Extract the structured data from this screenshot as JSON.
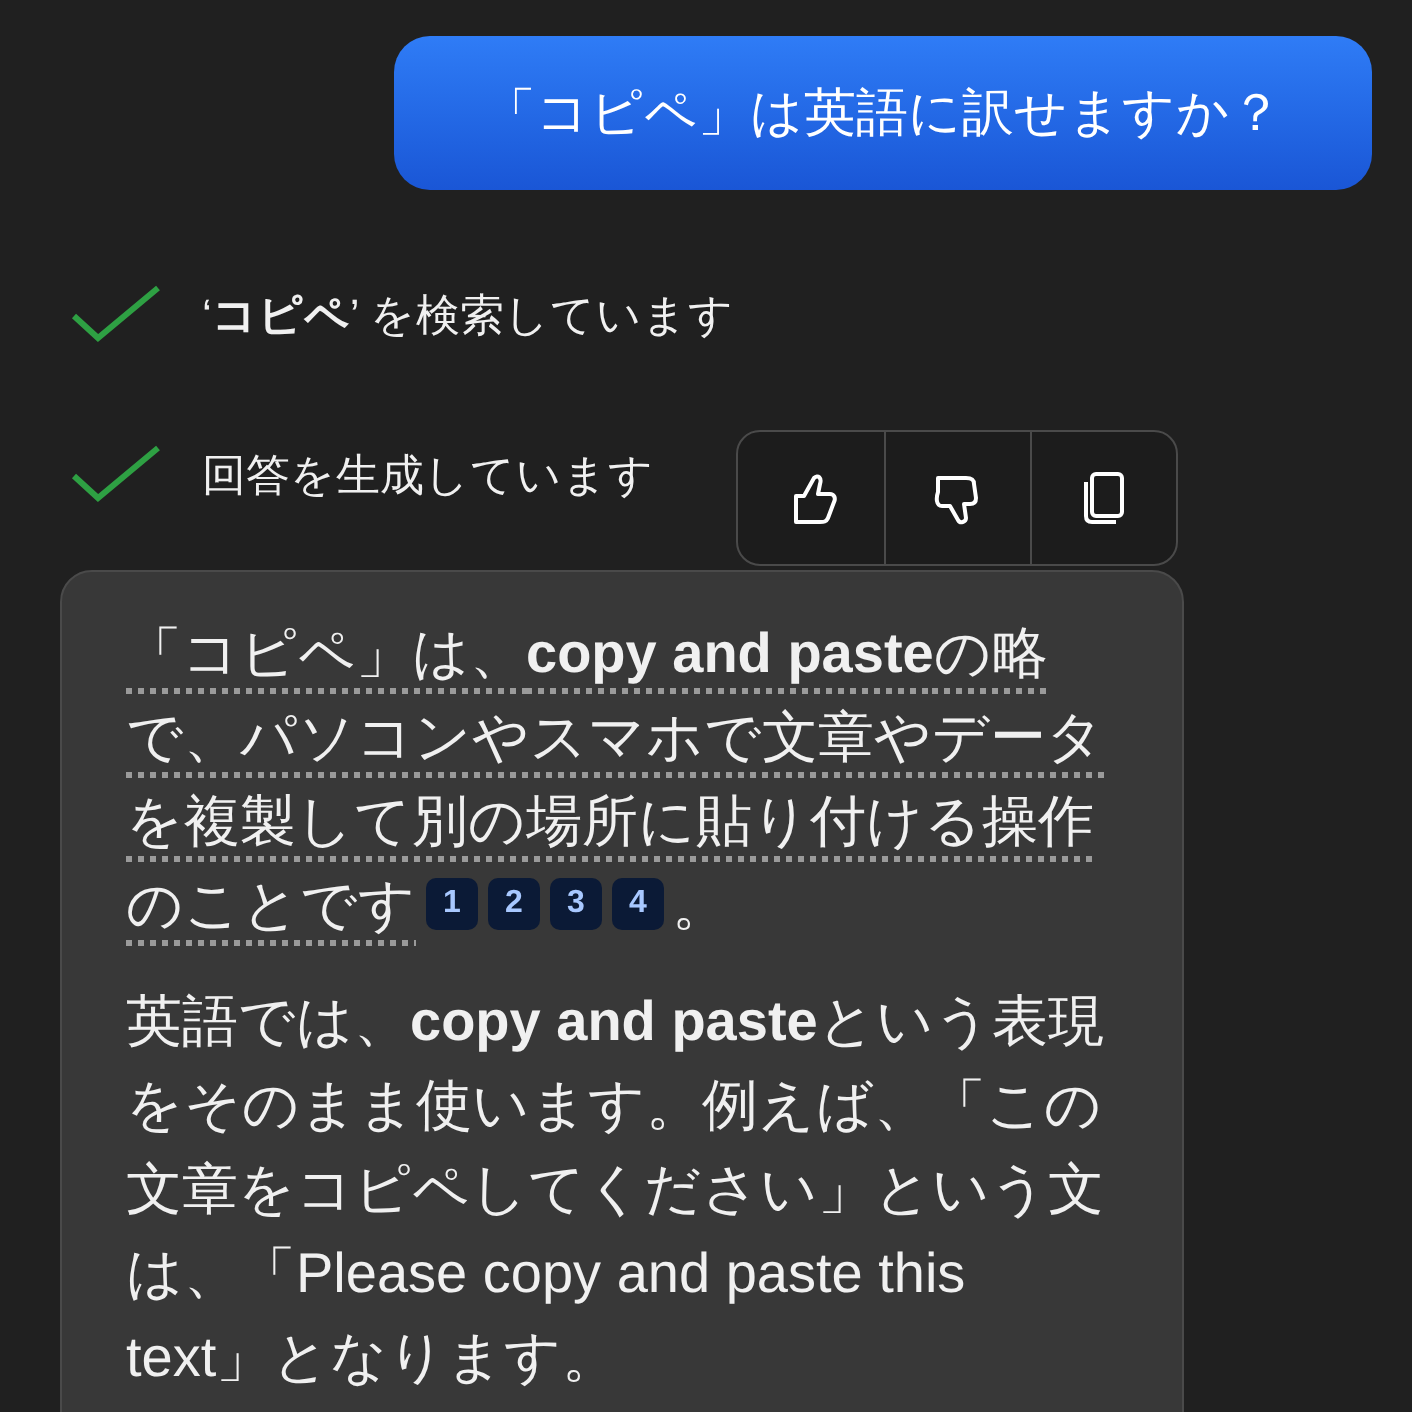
{
  "user_message": "「コピペ」は英語に訳せますか？",
  "steps": [
    {
      "text": "‘**コピペ**’ を検索しています",
      "done": true
    },
    {
      "text": "回答を生成しています",
      "done": true
    }
  ],
  "feedback_toolbar": {
    "buttons": [
      {
        "kind": "like"
      },
      {
        "kind": "dislike"
      },
      {
        "kind": "copy"
      }
    ]
  },
  "answer": {
    "paragraphs": [
      {
        "kind": "cited",
        "text": "「コピペ」は、**copy and paste**の略で、パソコンやスマホで文章やデータを複製して別の場所に貼り付ける操作のことです",
        "citations": [
          "1",
          "2",
          "3",
          "4"
        ],
        "tail": "。"
      },
      {
        "kind": "plain",
        "text": "英語では、**copy and paste**という表現をそのまま使います。例えば、「この文章をコピペしてください」という文は、「Please copy and paste this text」となります。"
      }
    ]
  }
}
